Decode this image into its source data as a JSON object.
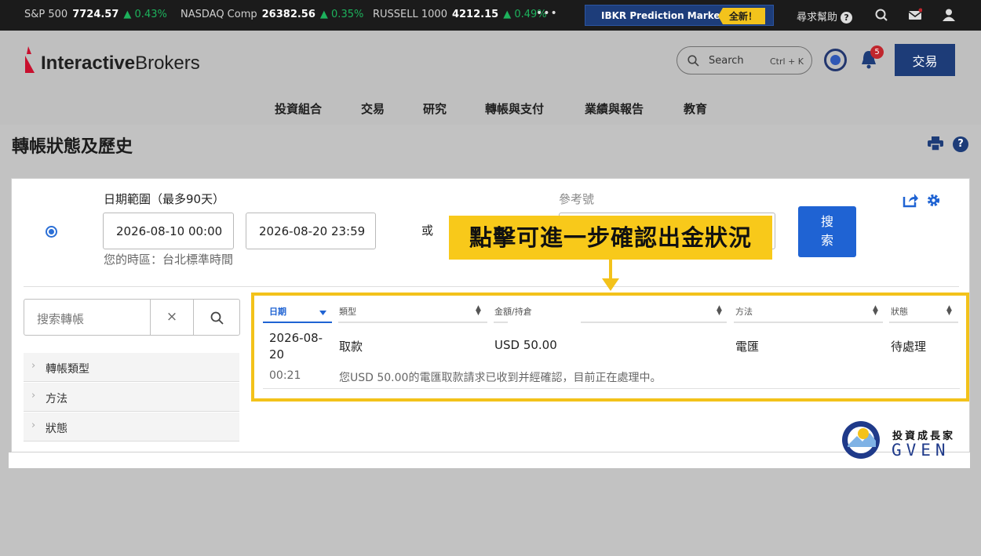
{
  "ticker": {
    "items": [
      {
        "name": "S&P 500",
        "value": "7724.57",
        "change": "▲ 0.43%"
      },
      {
        "name": "NASDAQ Comp",
        "value": "26382.56",
        "change": "▲ 0.35%"
      },
      {
        "name": "RUSSELL 1000",
        "value": "4212.15",
        "change": "▲ 0.49%"
      }
    ],
    "more": "•••",
    "promo_label": "IBKR Prediction Markets",
    "promo_badge": "全新！",
    "help_label": "尋求幫助",
    "up_color": "#1db25c"
  },
  "header": {
    "logo_text_bold": "Interactive",
    "logo_text_rest": "Brokers",
    "search_label": "Search",
    "search_shortcut": "Ctrl + K",
    "notification_count": "5",
    "trade_button": "交易",
    "nav": [
      "投資組合",
      "交易",
      "研究",
      "轉帳與支付",
      "業績與報告",
      "教育"
    ]
  },
  "page": {
    "title": "轉帳狀態及歷史",
    "help_glyph": "?"
  },
  "filters": {
    "date_range_label": "日期範圍（最多90天）",
    "from_date": "2026-08-10 00:00",
    "to_date": "2026-08-20 23:59",
    "timezone_note": "您的時區：台北標準時間",
    "or_label": "或",
    "reference_label": "參考號",
    "search_button": "搜\n索"
  },
  "callout": "點擊可進一步確認出金狀況",
  "sidebar": {
    "search_placeholder": "搜索轉帳",
    "clear_glyph": "×",
    "filters": [
      "轉帳類型",
      "方法",
      "狀態"
    ]
  },
  "table": {
    "columns": [
      "日期",
      "類型",
      "金額/持倉",
      "方法",
      "狀態"
    ],
    "rows": [
      {
        "date_line1": "2026-08-",
        "date_line2": "20",
        "time": "00:21",
        "type": "取款",
        "amount": "USD 50.00",
        "method": "電匯",
        "status": "待處理",
        "note": "您USD 50.00的電匯取款請求已收到并經確認，目前正在處理中。"
      }
    ]
  },
  "watermark": {
    "cn": "投資成長家",
    "en": "GVEN"
  },
  "colors": {
    "brand_blue": "#1d3c78",
    "action_blue": "#1f63d3",
    "highlight_yellow": "#f3c21a"
  }
}
